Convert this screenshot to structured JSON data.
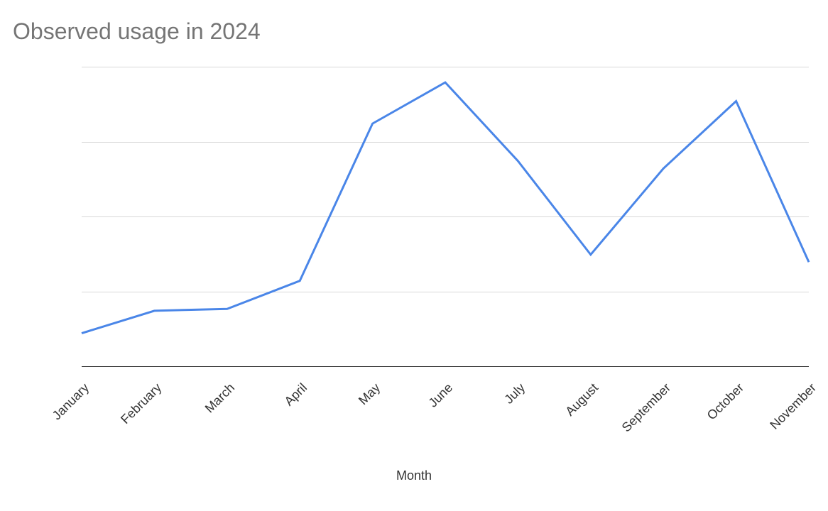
{
  "chart_data": {
    "type": "line",
    "title": "Observed usage in 2024",
    "xlabel": "Month",
    "ylabel": "",
    "categories": [
      "January",
      "February",
      "March",
      "April",
      "May",
      "June",
      "July",
      "August",
      "September",
      "October",
      "November"
    ],
    "values": [
      0.9,
      1.5,
      1.55,
      2.3,
      6.5,
      7.6,
      5.5,
      3.0,
      5.3,
      7.1,
      2.8
    ],
    "ylim": [
      0,
      8
    ],
    "gridlines_y": [
      0,
      2,
      4,
      6,
      8
    ],
    "line_color": "#4a86e8"
  }
}
